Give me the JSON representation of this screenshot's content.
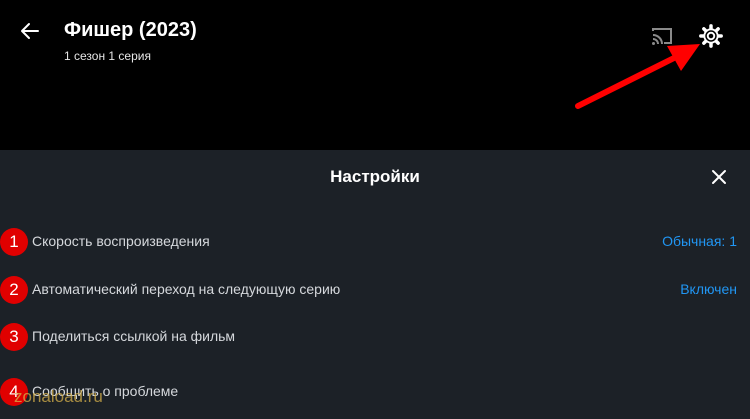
{
  "header": {
    "title": "Фишер (2023)",
    "subtitle": "1 сезон 1 серия"
  },
  "settings": {
    "title": "Настройки",
    "items": [
      {
        "num": "1",
        "label": "Скорость воспроизведения",
        "value": "Обычная: 1"
      },
      {
        "num": "2",
        "label": "Автоматический переход на следующую серию",
        "value": "Включен"
      },
      {
        "num": "3",
        "label": "Поделиться ссылкой на фильм"
      },
      {
        "num": "4",
        "label": "Сообщить о проблеме"
      }
    ]
  },
  "watermark": "zonaload.ru",
  "colors": {
    "accent": "#2196f3",
    "annotation": "#e00000",
    "sheet": "#1c2127"
  }
}
